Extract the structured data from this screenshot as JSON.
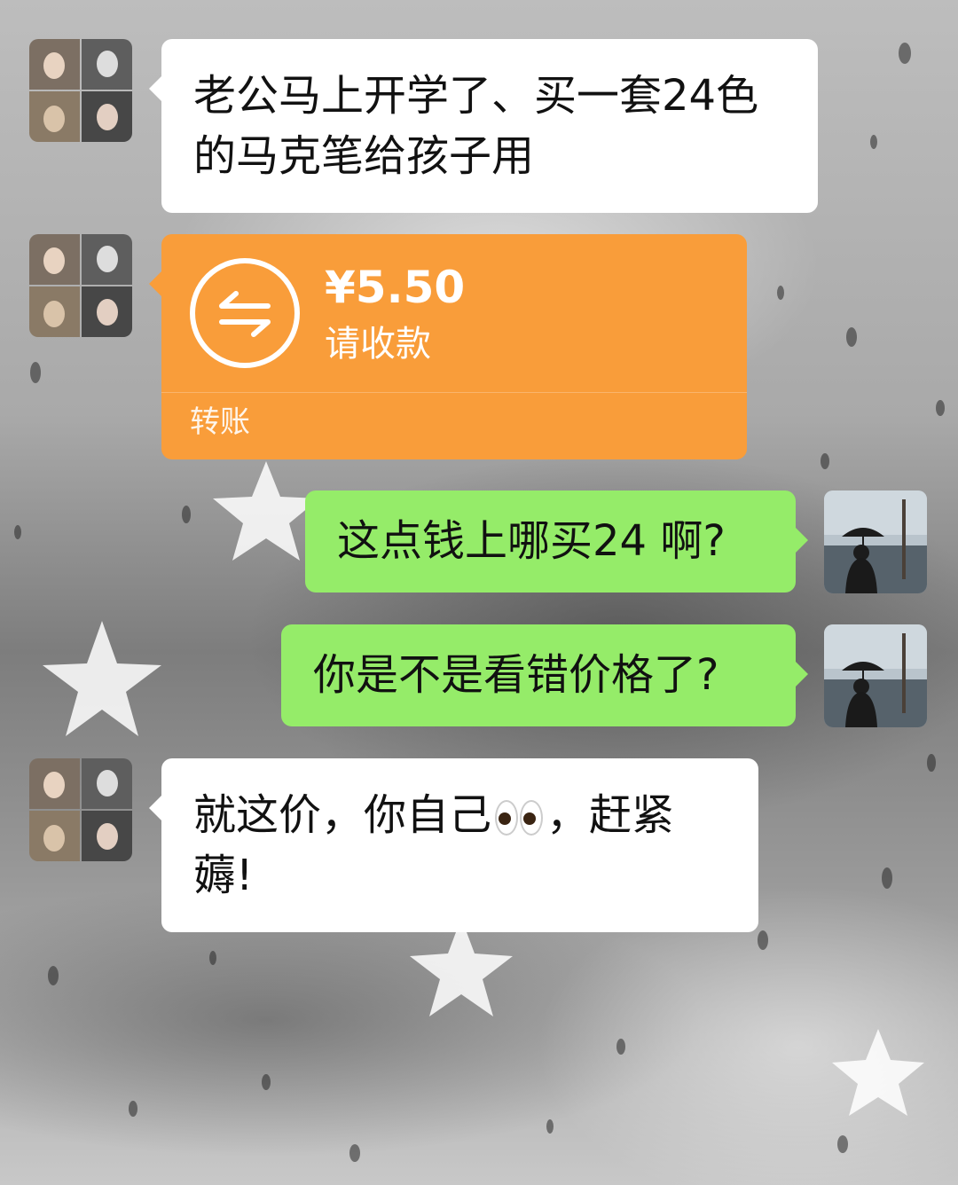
{
  "messages": [
    {
      "sender": "other",
      "type": "text",
      "text": "老公马上开学了、买一套24色的马克笔给孩子用"
    },
    {
      "sender": "other",
      "type": "transfer",
      "amount": "¥5.50",
      "note": "请收款",
      "label": "转账"
    },
    {
      "sender": "self",
      "type": "text",
      "text": "这点钱上哪买24 啊?"
    },
    {
      "sender": "self",
      "type": "text",
      "text": "你是不是看错价格了?"
    },
    {
      "sender": "other",
      "type": "text",
      "text_before": "就这价，你自己",
      "emoji": "eyes-emoji",
      "text_after": "，赶紧薅!"
    }
  ],
  "colors": {
    "incoming_bubble": "#ffffff",
    "outgoing_bubble": "#95ec69",
    "transfer_card": "#f99d3a"
  },
  "icons": [
    "transfer-arrows-icon",
    "eyes-emoji"
  ]
}
